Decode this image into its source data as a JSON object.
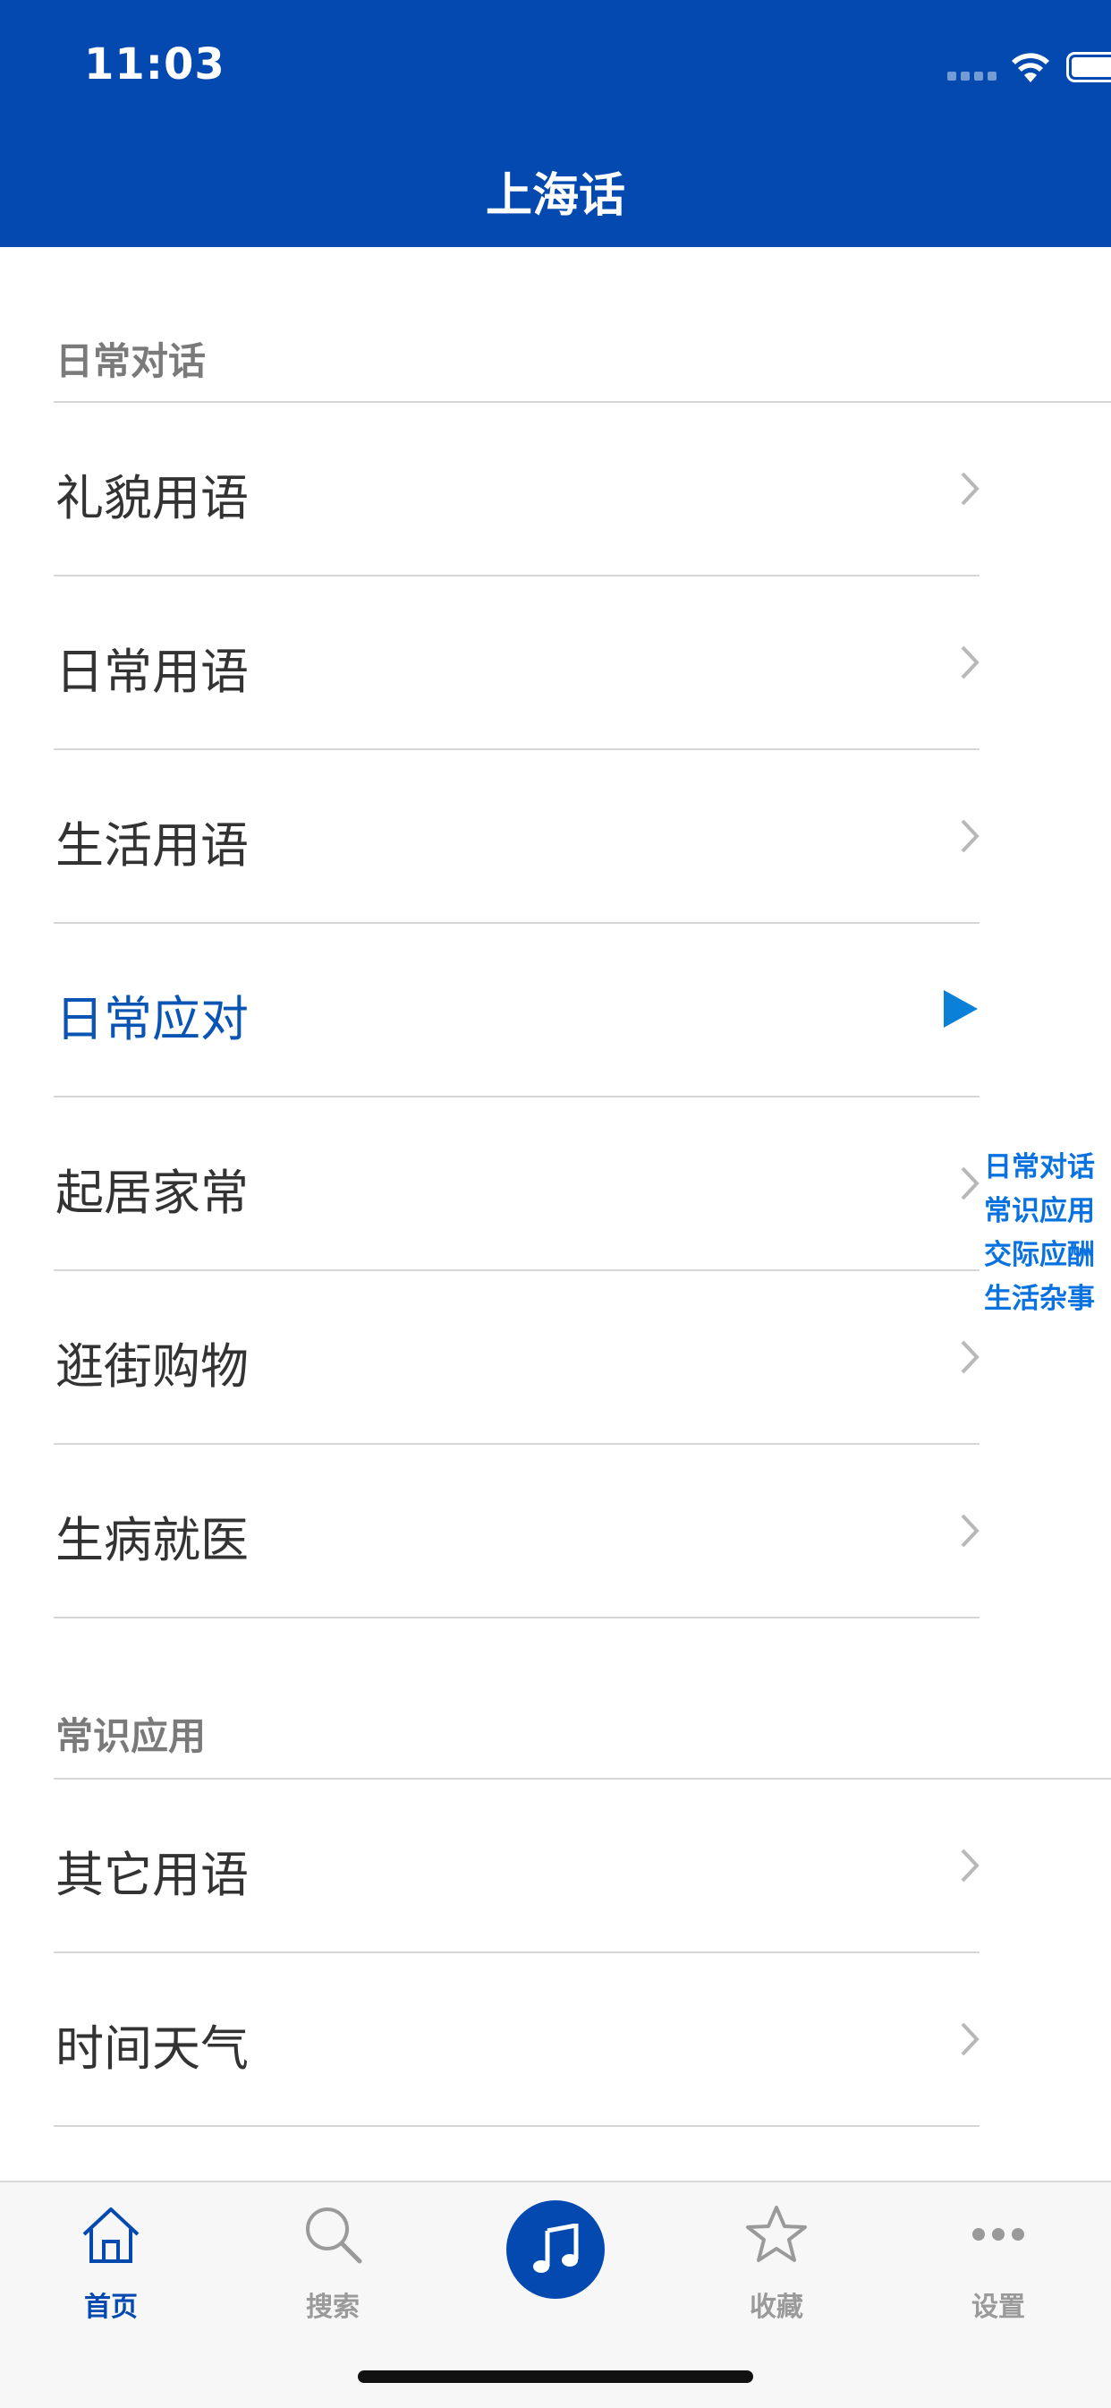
{
  "status": {
    "time": "11:03"
  },
  "nav": {
    "title": "上海话"
  },
  "sections": [
    {
      "title": "日常对话"
    },
    {
      "title": "常识应用"
    }
  ],
  "rows": [
    {
      "label": "礼貌用语"
    },
    {
      "label": "日常用语"
    },
    {
      "label": "生活用语"
    },
    {
      "label": "日常应对",
      "state": "playing"
    },
    {
      "label": "起居家常"
    },
    {
      "label": "逛街购物"
    },
    {
      "label": "生病就医"
    },
    {
      "label": "其它用语"
    },
    {
      "label": "时间天气"
    }
  ],
  "index": [
    "日常对话",
    "常识应用",
    "交际应酬",
    "生活杂事"
  ],
  "tabs": [
    {
      "label": "首页",
      "icon": "home-icon"
    },
    {
      "label": "搜索",
      "icon": "search-icon"
    },
    {
      "label": "",
      "icon": "music-note-icon"
    },
    {
      "label": "收藏",
      "icon": "star-icon"
    },
    {
      "label": "设置",
      "icon": "more-icon"
    }
  ],
  "colors": {
    "brand": "#0449B0",
    "active_text": "#0A55B4",
    "index_text": "#0A72E0",
    "play": "#0A80D8"
  }
}
